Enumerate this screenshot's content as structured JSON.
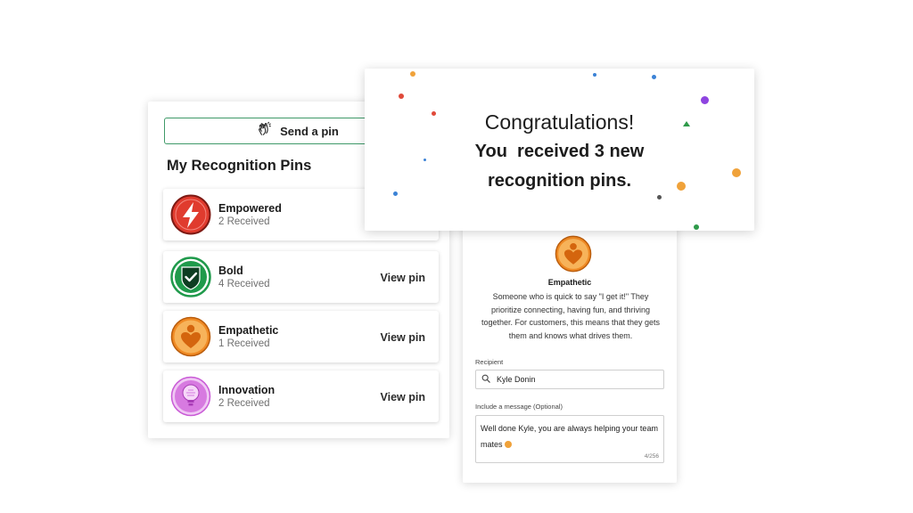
{
  "pins_panel": {
    "send_button": "Send a pin",
    "title": "My Recognition Pins",
    "pins": [
      {
        "name": "Empowered",
        "count": "2 Received",
        "view": "",
        "icon": "lightning-bolt-icon",
        "color": "#e03b2e"
      },
      {
        "name": "Bold",
        "count": "4 Received",
        "view": "View pin",
        "icon": "shield-check-icon",
        "color": "#1f9a4b"
      },
      {
        "name": "Empathetic",
        "count": "1 Received",
        "view": "View pin",
        "icon": "person-heart-icon",
        "color": "#f08a24"
      },
      {
        "name": "Innovation",
        "count": "2 Received",
        "view": "View pin",
        "icon": "lightbulb-icon",
        "color": "#c95ad6"
      }
    ]
  },
  "congrats": {
    "title": "Congratulations!",
    "line1": "You  received 3 new",
    "line2": "recognition pins."
  },
  "send_form": {
    "pin_name": "Empathetic",
    "pin_description": "Someone who is quick to say \"I get it!\" They prioritize connecting, having fun, and thriving together. For customers, this means that they gets them and knows what drives them.",
    "recipient_label": "Recipient",
    "recipient_value": "Kyle Donin",
    "message_label": "Include a message (Optional)",
    "message_text": "Well done Kyle, you are always helping your team mates",
    "char_count": "4/256"
  },
  "colors": {
    "send_border": "#3f9a69",
    "empowered": "#e03b2e",
    "bold": "#1f9a4b",
    "empathetic": "#f08a24",
    "innovation": "#c95ad6"
  }
}
